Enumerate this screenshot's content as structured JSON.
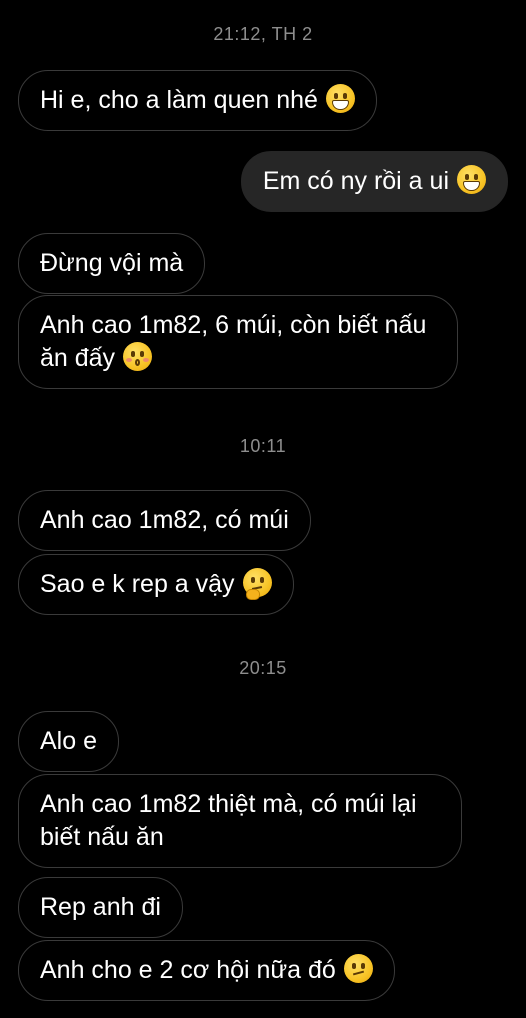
{
  "chat": {
    "timestamps": {
      "t1": "21:12, TH 2",
      "t2": "10:11",
      "t3": "20:15"
    },
    "messages": [
      {
        "direction": "incoming",
        "text": "Hi e, cho a làm quen nhé",
        "emoji": "grinning-face-icon"
      },
      {
        "direction": "outgoing",
        "text": "Em có ny rồi a ui",
        "emoji": "grinning-face-icon"
      },
      {
        "direction": "incoming",
        "text": "Đừng vội mà"
      },
      {
        "direction": "incoming",
        "text": "Anh cao 1m82, 6 múi, còn biết nấu ăn đấy",
        "emoji": "kissing-face-icon"
      },
      {
        "direction": "incoming",
        "text": "Anh cao 1m82, có múi"
      },
      {
        "direction": "incoming",
        "text": "Sao e k rep a vậy",
        "emoji": "thinking-face-icon"
      },
      {
        "direction": "incoming",
        "text": "Alo e"
      },
      {
        "direction": "incoming",
        "text": "Anh cao 1m82 thiệt mà, có múi lại biết nấu ăn"
      },
      {
        "direction": "incoming",
        "text": "Rep anh đi"
      },
      {
        "direction": "incoming",
        "text": "Anh cho e 2 cơ hội nữa đó",
        "emoji": "confused-face-icon"
      }
    ]
  },
  "colors": {
    "background": "#000000",
    "outgoing_bubble": "#262626",
    "incoming_border": "#3a3a3a",
    "timestamp": "#8e8e8e"
  }
}
